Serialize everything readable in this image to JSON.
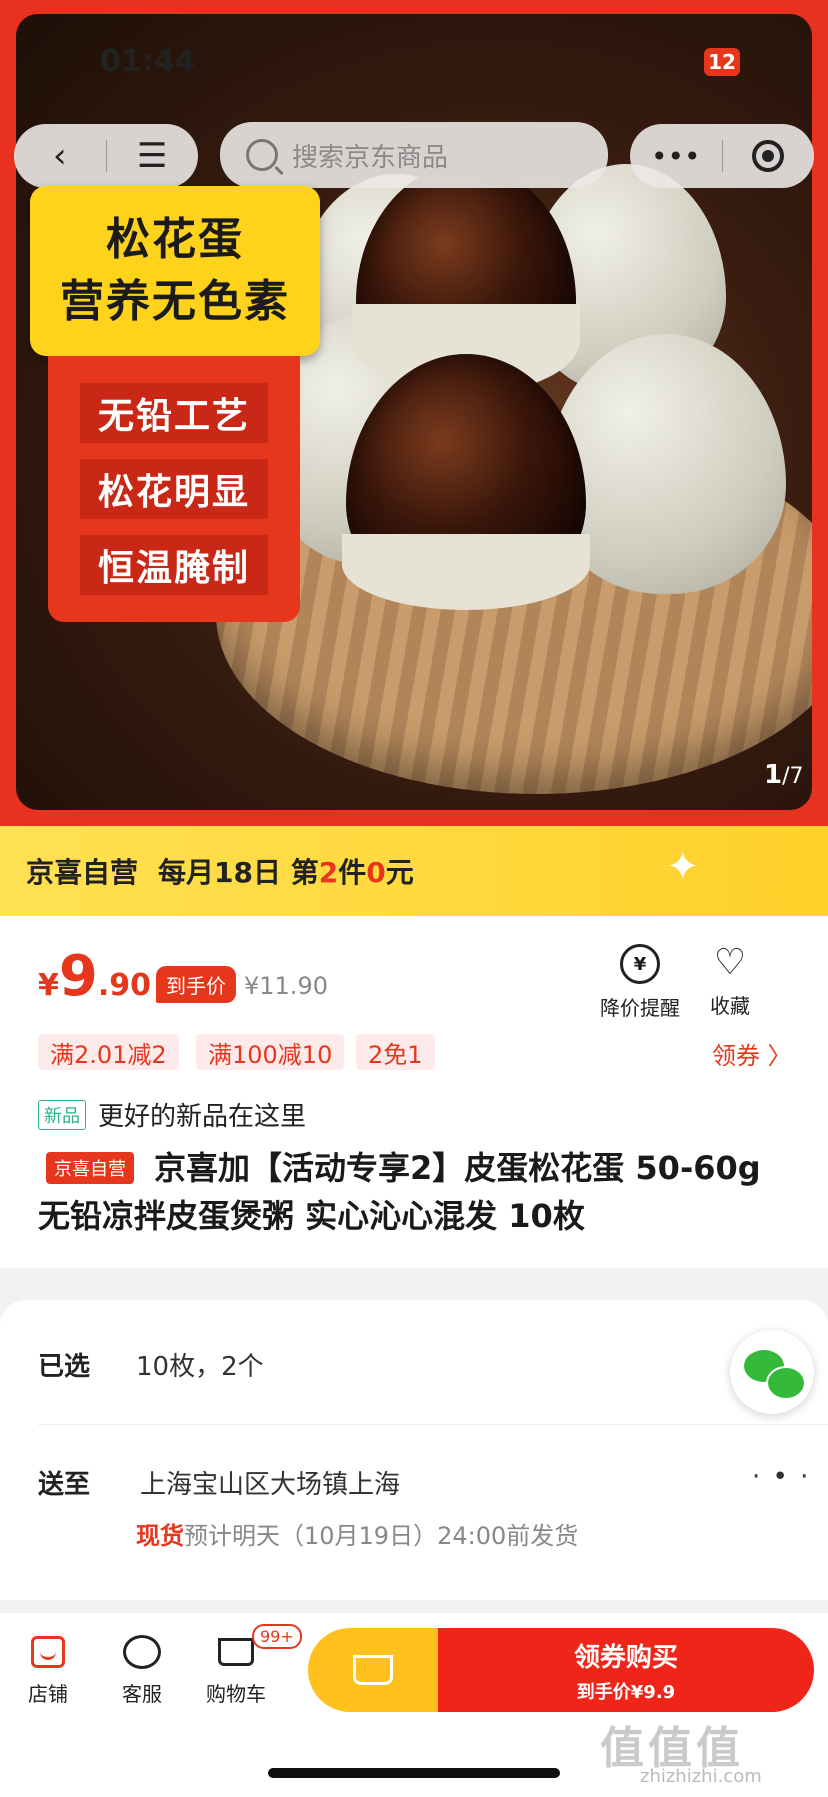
{
  "status": {
    "time": "01:44",
    "battery": "12"
  },
  "nav": {
    "back_icon": "chevron-left-icon",
    "menu_icon": "hamburger-icon",
    "more_icon": "more-dots-icon",
    "target_icon": "target-icon"
  },
  "search": {
    "placeholder": "搜索京东商品"
  },
  "hero": {
    "badge_title_1": "松花蛋",
    "badge_title_2": "营养无色素",
    "features": [
      "无铅工艺",
      "松花明显",
      "恒温腌制"
    ],
    "counter_current": "1",
    "counter_total": "/7"
  },
  "promo": {
    "brand": "京喜自营",
    "text_a": "每月18日 第",
    "num_a": "2",
    "text_b": "件",
    "num_b": "0",
    "text_c": "元"
  },
  "price": {
    "currency": "¥",
    "integer": "9",
    "decimal": ".90",
    "tag": "到手价",
    "original": "¥11.90"
  },
  "actions": {
    "price_alert": "降价提醒",
    "favorite": "收藏"
  },
  "coupons": [
    "满2.01减2",
    "满100减10",
    "2免1"
  ],
  "get_coupon": "领券 〉",
  "newtag": {
    "tag": "新品",
    "text": "更好的新品在这里"
  },
  "product": {
    "self_tag": "京喜自营",
    "title": "京喜加【活动专享2】皮蛋松花蛋 50-60g 无铅凉拌皮蛋煲粥 实心沁心混发 10枚"
  },
  "selection": {
    "label": "已选",
    "value": "10枚，2个"
  },
  "delivery": {
    "label": "送至",
    "address": "上海宝山区大场镇上海",
    "stock": "现货",
    "eta": "预计明天（10月19日）24:00前发货",
    "more": "· • ·"
  },
  "bottom": {
    "shop": "店铺",
    "service": "客服",
    "cart": "购物车",
    "cart_badge": "99+",
    "buy_main": "领券购买",
    "buy_sub": "到手价¥9.9"
  },
  "watermark": {
    "text": "值值值",
    "url": "zhizhizhi.com"
  },
  "colors": {
    "accent": "#e6371d",
    "promo": "#ffd12a",
    "new": "#2fb38a"
  }
}
